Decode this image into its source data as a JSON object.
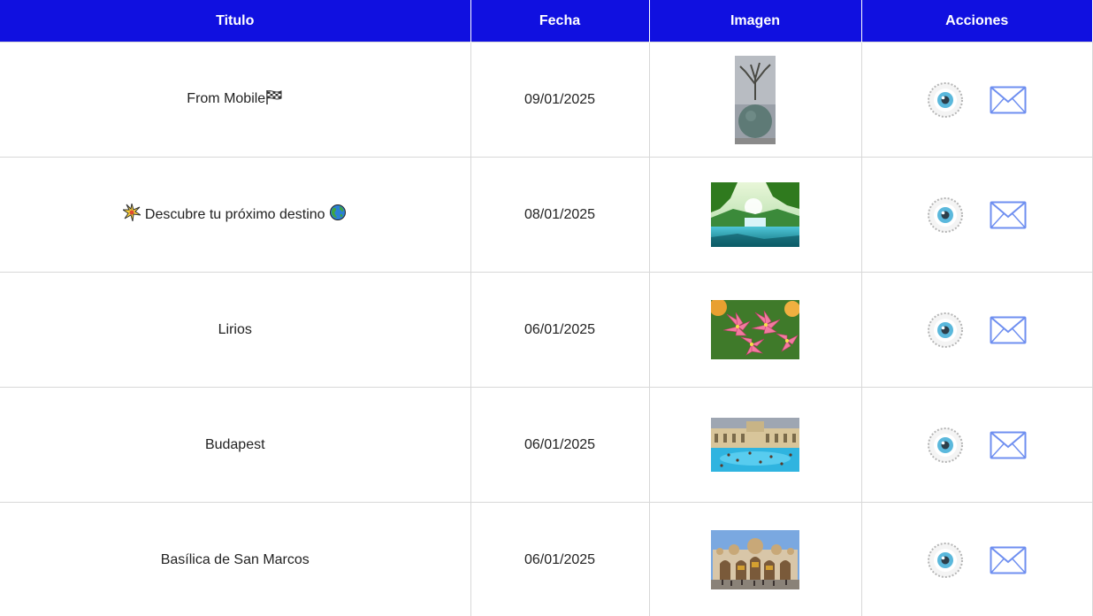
{
  "table": {
    "headers": {
      "titulo": "Titulo",
      "fecha": "Fecha",
      "imagen": "Imagen",
      "acciones": "Acciones"
    },
    "rows": [
      {
        "title": "From Mobile",
        "title_suffix_icon": "checkered-flag-icon",
        "date": "09/01/2025",
        "image": "tree-on-globe-sculpture-photo"
      },
      {
        "title": "Descubre tu próximo destino",
        "title_prefix_icon": "sparkle-burst-icon",
        "title_suffix_icon": "globe-icon",
        "date": "08/01/2025",
        "image": "waterfall-lake-photo"
      },
      {
        "title": "Lirios",
        "date": "06/01/2025",
        "image": "pink-lilies-photo"
      },
      {
        "title": "Budapest",
        "date": "06/01/2025",
        "image": "thermal-bath-pool-photo"
      },
      {
        "title": "Basílica de San Marcos",
        "date": "06/01/2025",
        "image": "basilica-facade-photo"
      }
    ],
    "row_actions": [
      "eye-icon",
      "envelope-icon"
    ]
  },
  "colors": {
    "header_bg": "#1010e0",
    "header_text": "#ffffff",
    "grid_line": "#d8d8d8",
    "envelope_stroke": "#6f8ff0",
    "eye_iris": "#5ab8dc"
  }
}
